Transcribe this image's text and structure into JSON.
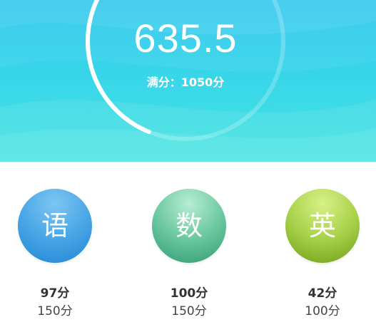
{
  "summary": {
    "total_score": "635.5",
    "full_score_label": "满分：1050分",
    "progress_fraction": 0.605
  },
  "subjects": [
    {
      "name": "语",
      "score": "97分",
      "full": "150分",
      "color": "#3a9ee4"
    },
    {
      "name": "数",
      "score": "100分",
      "full": "150分",
      "color": "#4fb88a"
    },
    {
      "name": "英",
      "score": "42分",
      "full": "100分",
      "color": "#93c23a"
    }
  ]
}
